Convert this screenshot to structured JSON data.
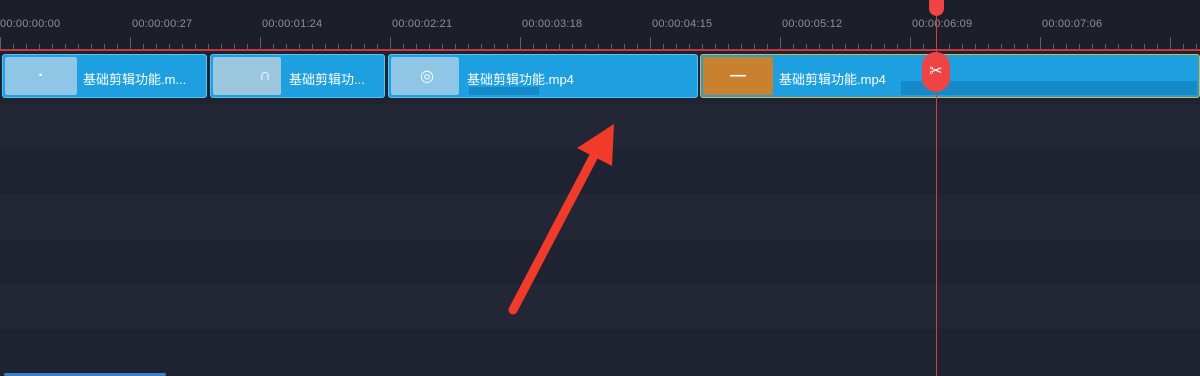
{
  "ruler": {
    "labels": [
      "00:00:00:00",
      "00:00:00:27",
      "00:00:01:24",
      "00:00:02:21",
      "00:00:03:18",
      "00:00:04:15",
      "00:00:05:12",
      "00:00:06:09",
      "00:00:07:06"
    ]
  },
  "clips": [
    {
      "name": "基础剪辑功能.m...",
      "icon": "·"
    },
    {
      "name": "基础剪辑功...",
      "icon": "∩"
    },
    {
      "name": "基础剪辑功能.mp4",
      "icon": "◎"
    },
    {
      "name": "基础剪辑功能.mp4",
      "icon": "—"
    }
  ],
  "playhead": {
    "split_icon": "✂"
  },
  "colors": {
    "background": "#1f2230",
    "clip": "#1d9fe0",
    "playhead": "#ee4444",
    "arrow": "#f03a2a",
    "selected_clip_border": "#e0b33b"
  }
}
